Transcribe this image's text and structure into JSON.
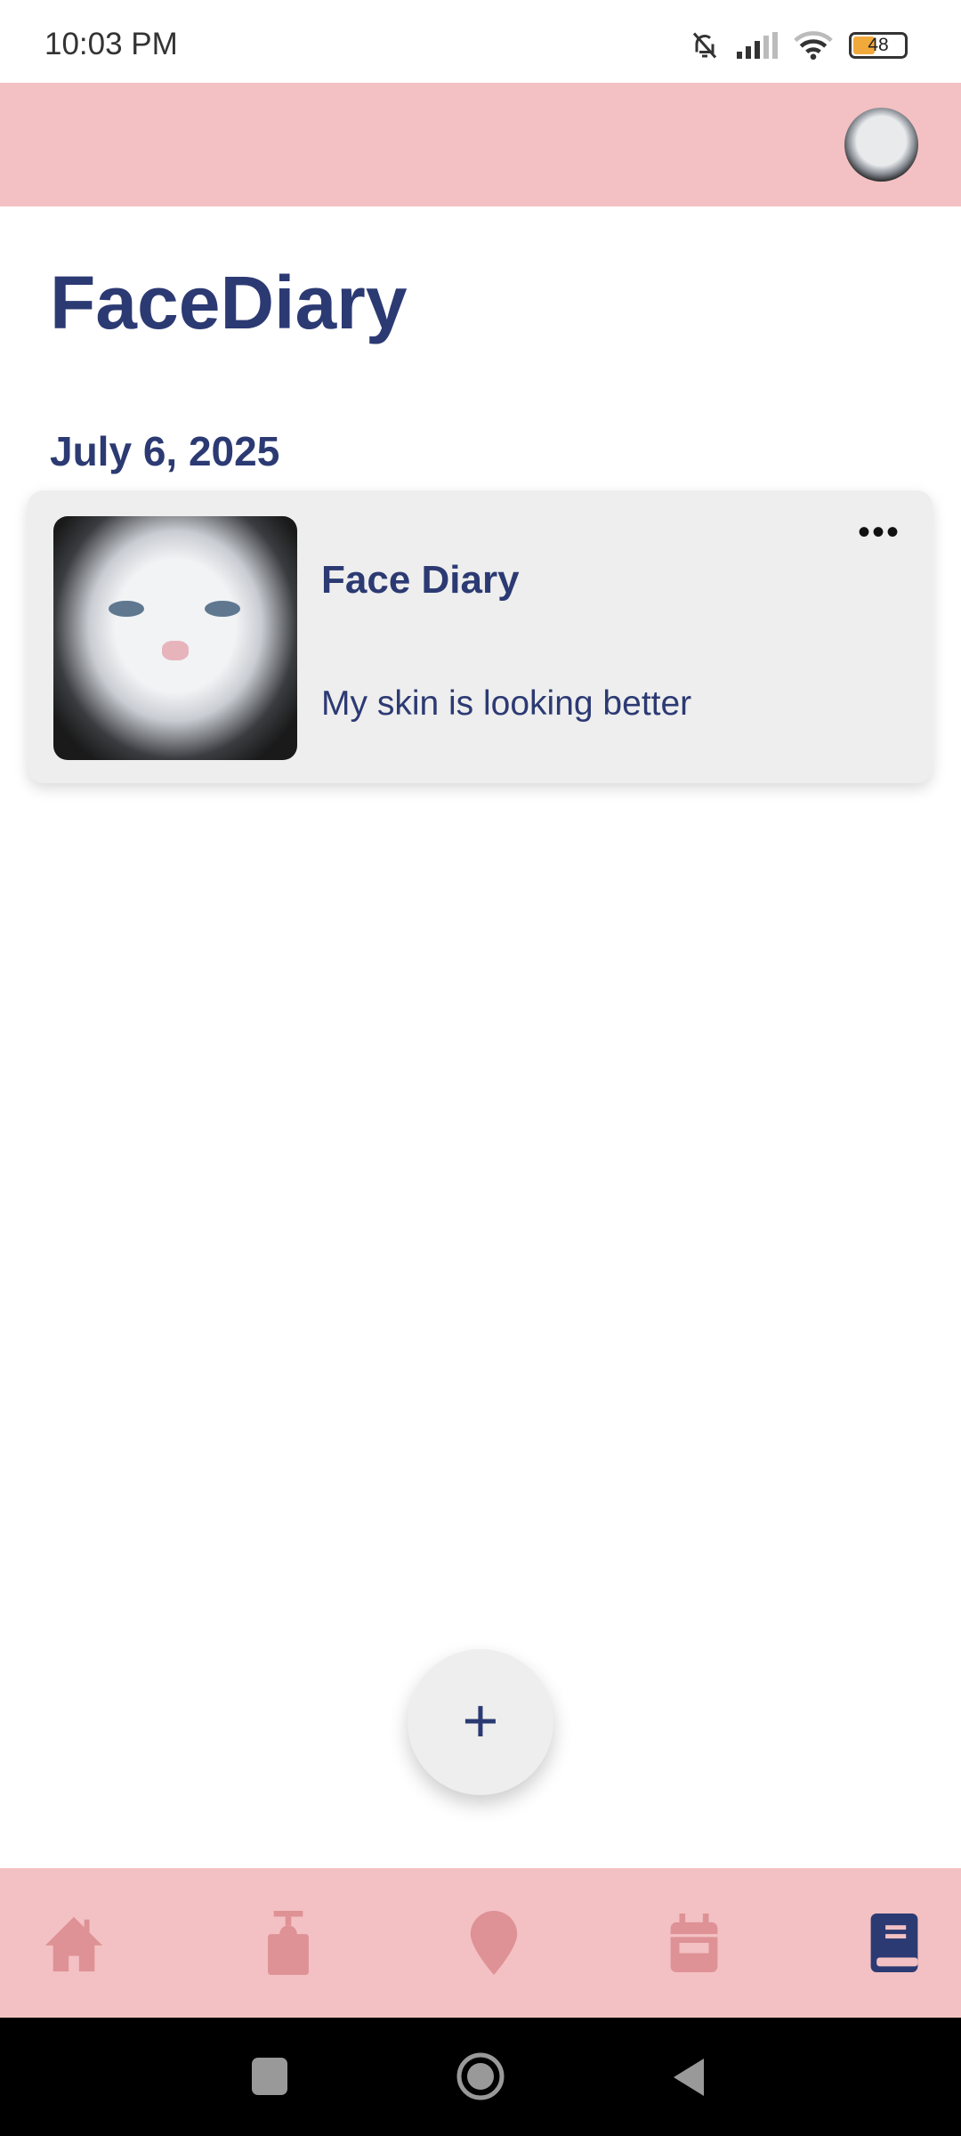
{
  "status_bar": {
    "time": "10:03 PM",
    "battery": "48",
    "icons": [
      "bell-off-icon",
      "signal-icon",
      "wifi-icon",
      "battery-icon"
    ]
  },
  "header": {
    "avatar": "profile-avatar"
  },
  "page": {
    "title": "FaceDiary"
  },
  "entries": [
    {
      "date": "July 6, 2025",
      "title": "Face Diary",
      "text": "My skin is looking better",
      "menu": "•••"
    }
  ],
  "fab": {
    "label": "+"
  },
  "bottom_nav": {
    "items": [
      "home-icon",
      "cleanser-icon",
      "location-icon",
      "calendar-icon",
      "diary-icon"
    ],
    "active": "diary-icon",
    "colors": {
      "inactive": "#de9296",
      "active": "#2c3a73",
      "background": "#f3c1c3"
    }
  }
}
